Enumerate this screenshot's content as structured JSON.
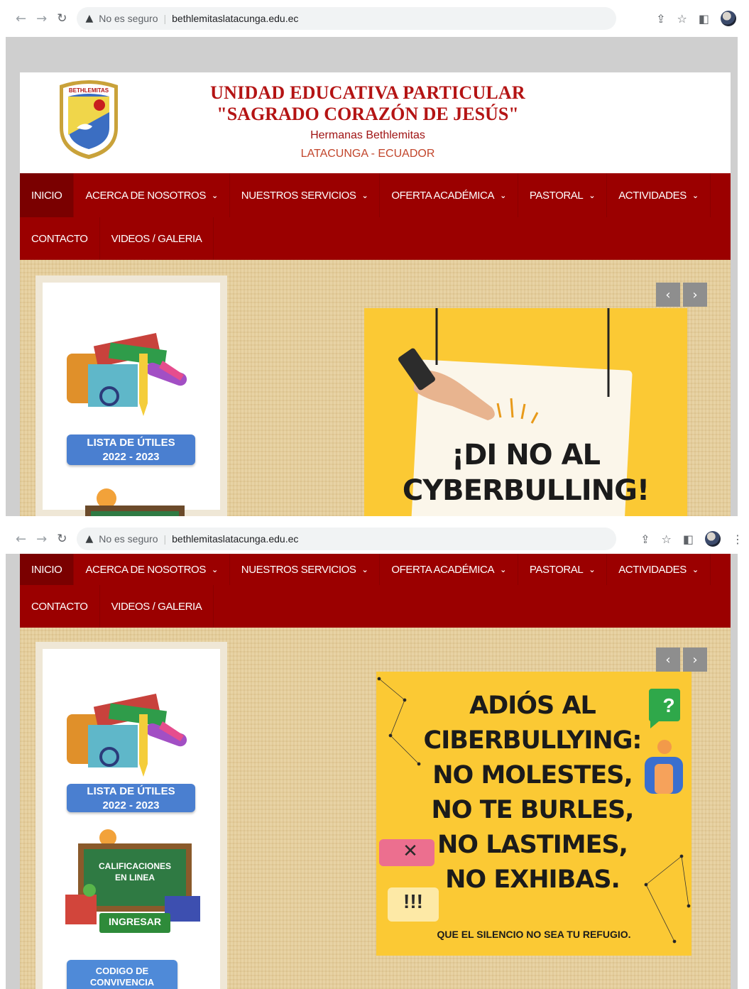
{
  "browser": {
    "warning_label": "No es seguro",
    "url": "bethlemitaslatacunga.edu.ec",
    "menu_glyph": "⋮"
  },
  "header": {
    "logo_text": "BETHLEMITAS",
    "title_line1": "UNIDAD EDUCATIVA PARTICULAR",
    "title_line2": "\"SAGRADO CORAZÓN DE JESÚS\"",
    "subtitle": "Hermanas Bethlemitas",
    "location": "LATACUNGA - ECUADOR"
  },
  "nav": {
    "inicio": "INICIO",
    "acerca": "ACERCA DE NOSOTROS",
    "servicios": "NUESTROS SERVICIOS",
    "oferta": "OFERTA ACADÉMICA",
    "pastoral": "PASTORAL",
    "actividades": "ACTIVIDADES",
    "contacto": "CONTACTO",
    "videos": "VIDEOS / GALERIA"
  },
  "sidebar": {
    "utiles_line1": "LISTA DE ÚTILES",
    "utiles_line2": "2022 - 2023",
    "calif_line1": "CALIFICACIONES",
    "calif_line2": "EN LINEA",
    "ingresar": "INGRESAR",
    "codigo_line1": "CODIGO DE",
    "codigo_line2": "CONVIVENCIA"
  },
  "slider": {
    "prev_glyph": "‹",
    "next_glyph": "›",
    "slide1_line1": "¡DI NO AL",
    "slide1_line2": "CYBERBULLING!",
    "slide2_lines": [
      "ADIÓS AL",
      "CIBERBULLYING:",
      "NO MOLESTES,",
      "NO TE BURLES,",
      "NO LASTIMES,",
      "NO EXHIBAS."
    ],
    "slide2_footer": "QUE EL SILENCIO NO SEA TU REFUGIO.",
    "bubble_question": "?",
    "bubble_x": "✕",
    "bubble_bang": "!!!"
  },
  "colors": {
    "nav_red": "#9b0000",
    "title_red": "#b41414",
    "slide_yellow": "#fbc934",
    "pill_blue": "#4a7fd0",
    "ingresar_green": "#2e8b3a"
  }
}
